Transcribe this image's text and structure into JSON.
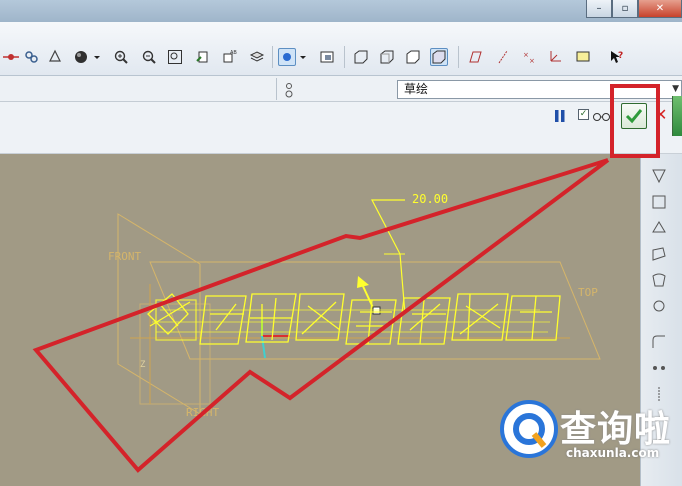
{
  "window": {
    "controls": {
      "minimize": "–",
      "maximize": "▫",
      "close": "✕"
    }
  },
  "toolbar": {
    "icons": [
      "spin-center-icon",
      "refit-icon",
      "shading-sphere-icon",
      "zoom-in-icon",
      "zoom-out-icon",
      "zoom-window-icon",
      "repaint-icon",
      "orient-icon",
      "layers-icon",
      "view-manager-icon",
      "saved-views-icon",
      "wireframe-icon",
      "hidden-line-icon",
      "no-hidden-icon",
      "shaded-icon",
      "datum-planes-icon",
      "datum-axes-icon",
      "datum-points-icon",
      "csys-icon",
      "annotations-icon",
      "whats-this-icon"
    ]
  },
  "sketch_select": {
    "value": "草绘"
  },
  "dashboard": {
    "preview_checked": "✓",
    "cancel_label": "✕"
  },
  "canvas": {
    "dimension_label": "20.00",
    "datum_labels": {
      "front": "FRONT",
      "top": "TOP",
      "right": "RIGHT"
    },
    "axis_label_z": "Z",
    "sketch_text_color": "#ffff2e"
  },
  "accent_colors": {
    "highlight_red": "#d4232a",
    "ok_green": "#2f9b3a",
    "sketch_yellow": "#ffff2e",
    "canvas_bg": "#a19a85"
  },
  "watermark": {
    "brand": "查询啦",
    "domain": "chaxunla.com"
  }
}
